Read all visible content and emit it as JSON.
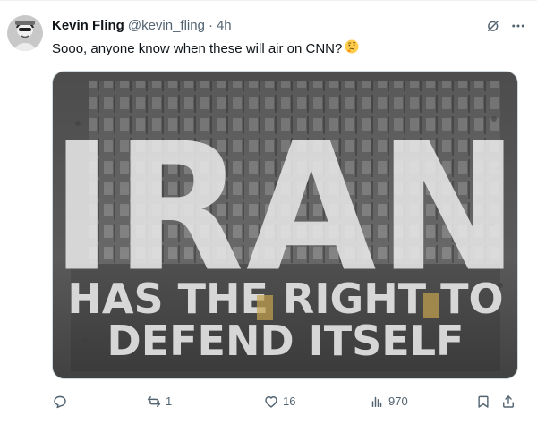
{
  "post": {
    "author": {
      "display_name": "Kevin Fling",
      "handle": "@kevin_fling",
      "separator": "·",
      "time": "4h"
    },
    "text": "Sooo, anyone know when these will air on CNN?",
    "emoji": "thinking-face",
    "media": {
      "headline": "IRAN",
      "subline_1": "HAS THE RIGHT TO",
      "subline_2": "DEFEND ITSELF"
    },
    "metrics": {
      "replies": "",
      "reposts": "1",
      "likes": "16",
      "views": "970"
    }
  },
  "icons": {
    "grok": "grok-icon",
    "more": "more-icon",
    "reply": "reply-icon",
    "repost": "repost-icon",
    "like": "heart-icon",
    "views": "views-icon",
    "bookmark": "bookmark-icon",
    "share": "share-icon"
  },
  "colors": {
    "text_primary": "#0f1419",
    "text_secondary": "#536471",
    "media_bg": "#5d5d5d",
    "media_text": "#e7e7e7"
  }
}
